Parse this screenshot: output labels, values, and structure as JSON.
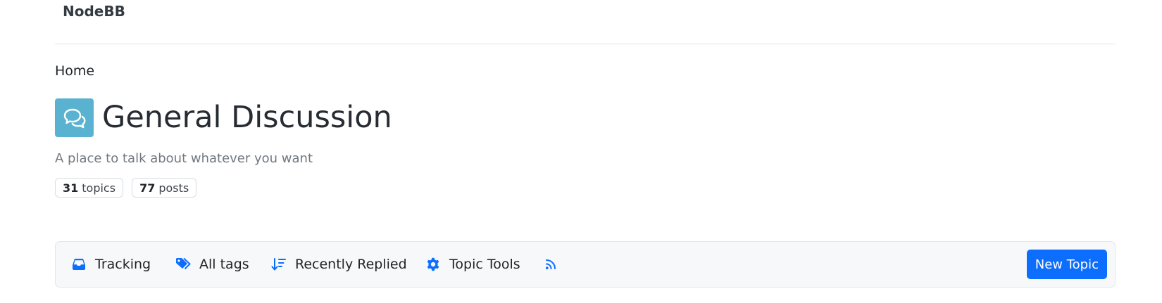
{
  "header": {
    "brand": "NodeBB"
  },
  "breadcrumb": {
    "home": "Home"
  },
  "category": {
    "icon": "comments-icon",
    "icon_bg": "#59b3d0",
    "title": "General Discussion",
    "description": "A place to talk about whatever you want",
    "stats": {
      "topics_count": "31",
      "topics_label": "topics",
      "posts_count": "77",
      "posts_label": "posts"
    }
  },
  "toolbar": {
    "accent": "#0d6efd",
    "items": [
      {
        "icon": "inbox-icon",
        "label": "Tracking"
      },
      {
        "icon": "tags-icon",
        "label": "All tags"
      },
      {
        "icon": "sort-descending-icon",
        "label": "Recently Replied"
      },
      {
        "icon": "gear-icon",
        "label": "Topic Tools"
      },
      {
        "icon": "rss-icon",
        "label": ""
      }
    ],
    "new_topic_label": "New Topic"
  }
}
